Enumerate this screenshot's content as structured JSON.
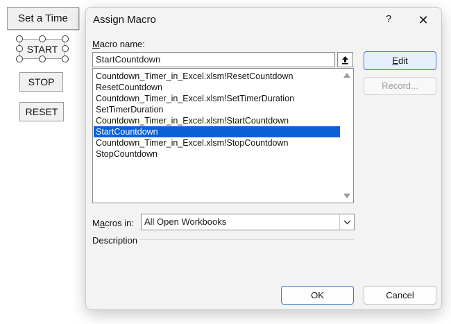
{
  "sheet": {
    "set_time_label": "Set a Time",
    "start_label": "START",
    "stop_label": "STOP",
    "reset_label": "RESET"
  },
  "dialog": {
    "title": "Assign Macro",
    "help_glyph": "?",
    "close_glyph": "✕",
    "macro_name_label": {
      "underlined": "M",
      "rest": "acro name:"
    },
    "macro_name_value": "StartCountdown",
    "macro_list": [
      "Countdown_Timer_in_Excel.xlsm!ResetCountdown",
      "ResetCountdown",
      "Countdown_Timer_in_Excel.xlsm!SetTimerDuration",
      "SetTimerDuration",
      "Countdown_Timer_in_Excel.xlsm!StartCountdown",
      "StartCountdown",
      "Countdown_Timer_in_Excel.xlsm!StopCountdown",
      "StopCountdown"
    ],
    "selected_index": 5,
    "edit_label": {
      "underlined": "E",
      "rest": "dit"
    },
    "record_label": "Record...",
    "macros_in_label": {
      "prefix": "M",
      "underlined": "a",
      "rest": "cros in:"
    },
    "macros_in_value": "All Open Workbooks",
    "description_label": "Description",
    "ok_label": "OK",
    "cancel_label": "Cancel"
  }
}
